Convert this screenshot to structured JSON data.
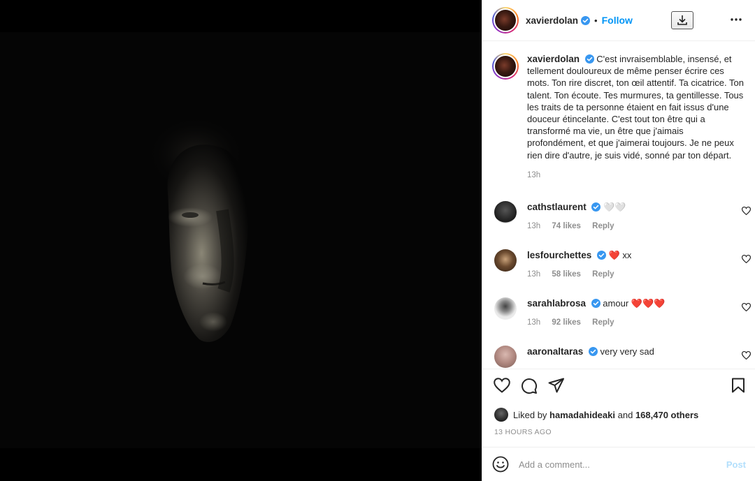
{
  "post": {
    "author": "xavierdolan",
    "follow_label": "Follow",
    "separator": "•"
  },
  "caption": {
    "username": "xavierdolan",
    "text": "C'est invraisemblable, insensé, et tellement douloureux de même penser écrire ces mots. Ton rire discret, ton œil attentif. Ta cicatrice. Ton talent. Ton écoute. Tes murmures, ta gentillesse. Tous les traits de ta personne étaient en fait issus d'une douceur étincelante. C'est tout ton être qui a transformé ma vie, un être que j'aimais profondément, et que j'aimerai toujours. Je ne peux rien dire d'autre, je suis vidé, sonné par ton départ.",
    "time": "13h"
  },
  "comments": [
    {
      "username": "cathstlaurent",
      "text": "🤍🤍",
      "time": "13h",
      "likes": "74 likes",
      "reply": "Reply",
      "avatar_color": "#2a2a2a"
    },
    {
      "username": "lesfourchettes",
      "text": "❤️ xx",
      "time": "13h",
      "likes": "58 likes",
      "reply": "Reply",
      "avatar_color": "#6b4a2f"
    },
    {
      "username": "sarahlabrosa",
      "text": "amour ❤️❤️❤️",
      "time": "13h",
      "likes": "92 likes",
      "reply": "Reply",
      "avatar_color": "#d8d8d8"
    },
    {
      "username": "aaronaltaras",
      "text": "very very sad",
      "avatar_color": "#c9a9a0"
    }
  ],
  "likes": {
    "prefix": "Liked by",
    "user": "hamadahideaki",
    "connector": "and",
    "others": "168,470 others"
  },
  "timestamp": "13 HOURS AGO",
  "composer": {
    "placeholder": "Add a comment...",
    "post_label": "Post"
  },
  "colors": {
    "accent": "#0095f6",
    "verified": "#3897f0",
    "post_disabled": "#b2dffc",
    "heart_red": "#ed4956"
  },
  "icons": [
    "verified-badge-icon",
    "download-icon",
    "more-options-icon",
    "heart-icon",
    "comment-icon",
    "share-icon",
    "bookmark-icon",
    "emoji-icon"
  ]
}
